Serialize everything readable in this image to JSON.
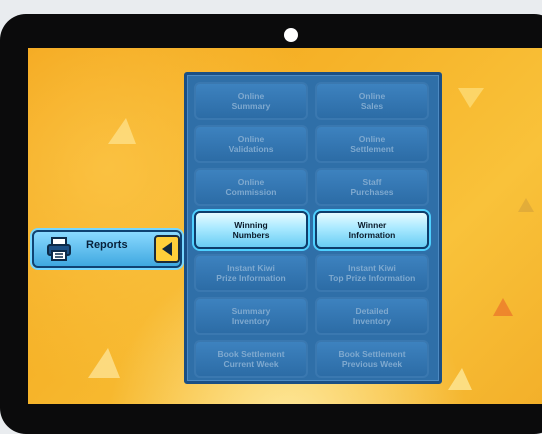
{
  "sidebar": {
    "reports_label": "Reports"
  },
  "menu": {
    "buttons": [
      {
        "label": "Online\nSummary",
        "active": false
      },
      {
        "label": "Online\nSales",
        "active": false
      },
      {
        "label": "Online\nValidations",
        "active": false
      },
      {
        "label": "Online\nSettlement",
        "active": false
      },
      {
        "label": "Online\nCommission",
        "active": false
      },
      {
        "label": "Staff\nPurchases",
        "active": false
      },
      {
        "label": "Winning\nNumbers",
        "active": true
      },
      {
        "label": "Winner\nInformation",
        "active": true
      },
      {
        "label": "Instant Kiwi\nPrize Information",
        "active": false
      },
      {
        "label": "Instant Kiwi\nTop Prize Information",
        "active": false
      },
      {
        "label": "Summary\nInventory",
        "active": false
      },
      {
        "label": "Detailed\nInventory",
        "active": false
      },
      {
        "label": "Book Settlement\nCurrent Week",
        "active": false
      },
      {
        "label": "Book Settlement\nPrevious Week",
        "active": false
      }
    ]
  },
  "colors": {
    "background_orange": "#f6b42a",
    "panel_blue": "#2f6fa8",
    "active_button": "#a9e9ff",
    "arrow_yellow": "#ffcf3a"
  }
}
